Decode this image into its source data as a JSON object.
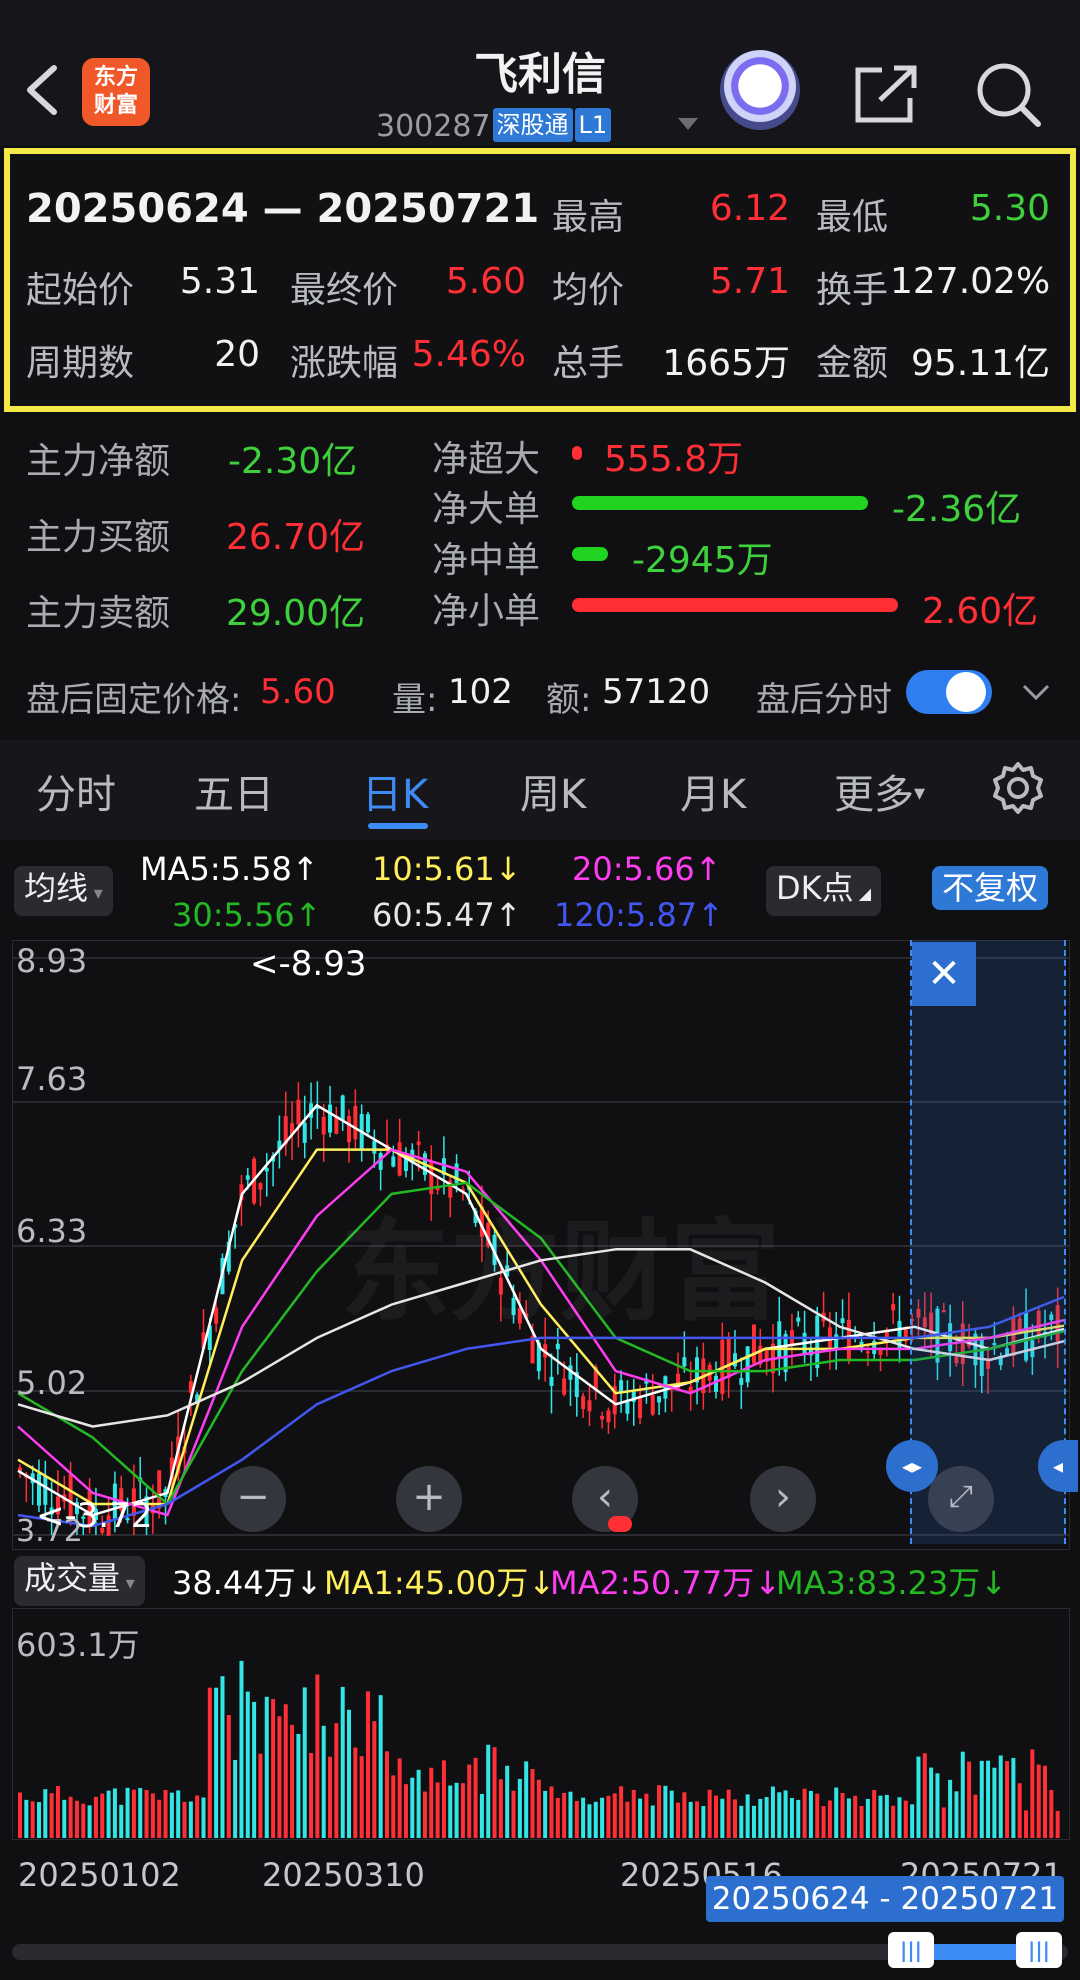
{
  "header": {
    "stock_name": "飞利信",
    "stock_code": "300287",
    "tag_market": "深股通",
    "tag_level": "L1",
    "logo_text": "东方财富",
    "logo_line1": "东方",
    "logo_line2": "财富"
  },
  "summary": {
    "range": "20250624 — 20250721",
    "high_label": "最高",
    "high": "6.12",
    "low_label": "最低",
    "low": "5.30",
    "open_label": "起始价",
    "open": "5.31",
    "close_label": "最终价",
    "close": "5.60",
    "avg_label": "均价",
    "avg": "5.71",
    "turnover_label": "换手",
    "turnover": "127.02%",
    "periods_label": "周期数",
    "periods": "20",
    "change_label": "涨跌幅",
    "change": "5.46%",
    "volume_label": "总手",
    "volume": "1665万",
    "amount_label": "金额",
    "amount": "95.11亿"
  },
  "fund_flow": {
    "net_main_label": "主力净额",
    "net_main": "-2.30亿",
    "buy_main_label": "主力买额",
    "buy_main": "26.70亿",
    "sell_main_label": "主力卖额",
    "sell_main": "29.00亿",
    "items": [
      {
        "label": "净超大",
        "value": "555.8万",
        "color": "#ff2f35",
        "level": 0.02
      },
      {
        "label": "净大单",
        "value": "-2.36亿",
        "color": "#21d321",
        "level": 0.78
      },
      {
        "label": "净中单",
        "value": "-2945万",
        "color": "#21d321",
        "level": 0.1
      },
      {
        "label": "净小单",
        "value": "2.60亿",
        "color": "#ff2f35",
        "level": 0.86
      }
    ]
  },
  "after_hours": {
    "price_label": "盘后固定价格:",
    "price": "5.60",
    "vol_label": "量:",
    "vol": "102",
    "amt_label": "额:",
    "amt": "57120",
    "toggle_label": "盘后分时",
    "toggle_on": true
  },
  "tabs": [
    "分时",
    "五日",
    "日K",
    "周K",
    "月K",
    "更多"
  ],
  "active_tab": "日K",
  "ma": {
    "selector": "均线",
    "ma5": "MA5:5.58↑",
    "ma10": "10:5.61↓",
    "ma20": "20:5.66↑",
    "ma30": "30:5.56↑",
    "ma60": "60:5.47↑",
    "ma120": "120:5.87↑",
    "dk_button": "DK点",
    "fq_button": "不复权",
    "colors": {
      "ma5": "#ffffff",
      "ma10": "#ffef5a",
      "ma20": "#ff3df0",
      "ma30": "#23b923",
      "ma60": "#e6e6e6",
      "ma120": "#4357f0"
    }
  },
  "kline": {
    "y_ticks": [
      "8.93",
      "7.63",
      "6.33",
      "5.02",
      "3.72"
    ],
    "max_marker": "<-8.93",
    "min_marker": "<-3.72",
    "watermark": "东方财富"
  },
  "volume": {
    "selector": "成交量",
    "cur": "38.44万↓",
    "ma1": "MA1:45.00万↓",
    "ma2": "MA2:50.77万↓",
    "ma3": "MA3:83.23万↓",
    "y_top": "603.1万"
  },
  "x_dates": [
    "20250102",
    "20250310",
    "20250516",
    "20250721"
  ],
  "range_badge": "20250624 - 20250721",
  "scroll": {
    "handle_left": "|||",
    "handle_right": "|||"
  },
  "chart_data": {
    "type": "line",
    "title": "",
    "x": [
      "20250102",
      "20250310",
      "20250516",
      "20250721"
    ],
    "ylim": [
      3.72,
      8.93
    ],
    "y_ticks": [
      8.93,
      7.63,
      6.33,
      5.02,
      3.72
    ],
    "series": [
      {
        "name": "MA5",
        "values": [
          4.3,
          3.9,
          4.1,
          6.8,
          7.6,
          7.2,
          6.8,
          5.4,
          4.9,
          5.1,
          5.4,
          5.5,
          5.6,
          5.4,
          5.58
        ]
      },
      {
        "name": "10",
        "values": [
          4.4,
          4.0,
          4.0,
          6.2,
          7.2,
          7.2,
          6.9,
          5.8,
          5.0,
          5.1,
          5.4,
          5.4,
          5.5,
          5.5,
          5.61
        ]
      },
      {
        "name": "20",
        "values": [
          4.7,
          4.1,
          3.9,
          5.6,
          6.6,
          7.2,
          7.0,
          6.2,
          5.2,
          5.0,
          5.3,
          5.4,
          5.4,
          5.5,
          5.66
        ]
      },
      {
        "name": "30",
        "values": [
          5.0,
          4.6,
          4.0,
          5.2,
          6.1,
          6.8,
          6.9,
          6.4,
          5.5,
          5.2,
          5.2,
          5.3,
          5.3,
          5.4,
          5.56
        ]
      },
      {
        "name": "60",
        "values": [
          4.9,
          4.7,
          4.8,
          5.1,
          5.5,
          5.8,
          6.0,
          6.2,
          6.3,
          6.3,
          6.0,
          5.6,
          5.4,
          5.3,
          5.47
        ]
      },
      {
        "name": "120",
        "values": [
          3.9,
          3.8,
          4.0,
          4.4,
          4.9,
          5.2,
          5.4,
          5.5,
          5.5,
          5.5,
          5.5,
          5.5,
          5.5,
          5.6,
          5.87
        ]
      }
    ]
  }
}
